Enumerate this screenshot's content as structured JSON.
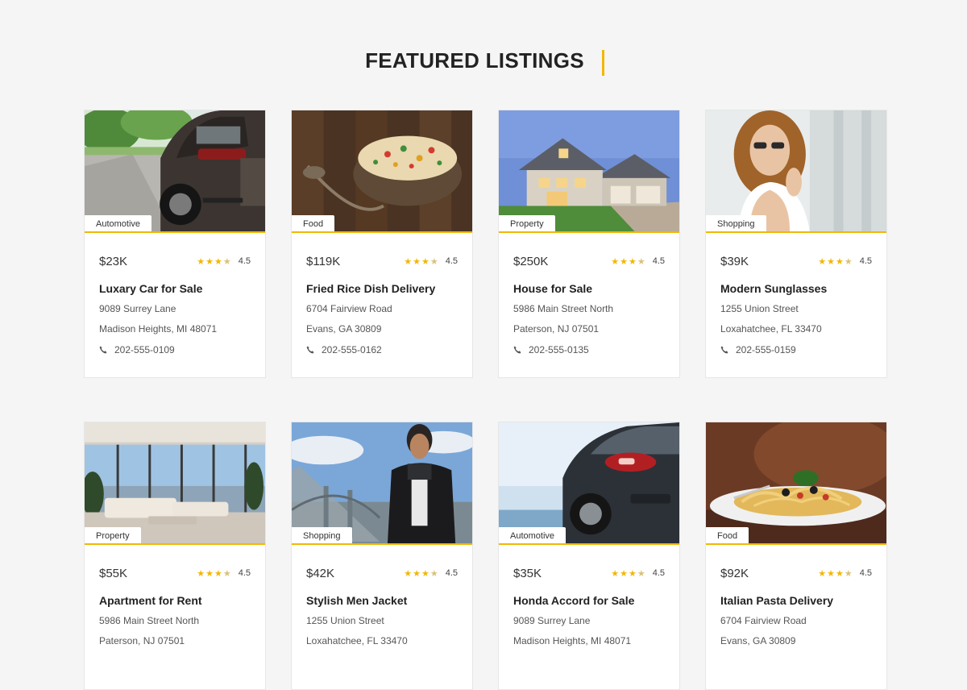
{
  "section_title": "FEATURED LISTINGS",
  "accent_color": "#f2b705",
  "listings": [
    {
      "category": "Automotive",
      "price": "$23K",
      "rating": "4.5",
      "title": "Luxary Car for Sale",
      "address_line1": "9089 Surrey Lane",
      "address_line2": "Madison Heights, MI 48071",
      "phone": "202-555-0109",
      "image": "car-on-road"
    },
    {
      "category": "Food",
      "price": "$119K",
      "rating": "4.5",
      "title": "Fried Rice Dish Delivery",
      "address_line1": "6704 Fairview Road",
      "address_line2": "Evans, GA 30809",
      "phone": "202-555-0162",
      "image": "fried-rice-bowl"
    },
    {
      "category": "Property",
      "price": "$250K",
      "rating": "4.5",
      "title": "House for Sale",
      "address_line1": "5986 Main Street North",
      "address_line2": "Paterson, NJ 07501",
      "phone": "202-555-0135",
      "image": "house-exterior"
    },
    {
      "category": "Shopping",
      "price": "$39K",
      "rating": "4.5",
      "title": "Modern Sunglasses",
      "address_line1": "1255 Union Street",
      "address_line2": "Loxahatchee, FL 33470",
      "phone": "202-555-0159",
      "image": "woman-sunglasses"
    },
    {
      "category": "Property",
      "price": "$55K",
      "rating": "4.5",
      "title": "Apartment for Rent",
      "address_line1": "5986 Main Street North",
      "address_line2": "Paterson, NJ 07501",
      "phone": "",
      "image": "apartment-interior"
    },
    {
      "category": "Shopping",
      "price": "$42K",
      "rating": "4.5",
      "title": "Stylish Men Jacket",
      "address_line1": "1255 Union Street",
      "address_line2": "Loxahatchee, FL 33470",
      "phone": "",
      "image": "man-jacket-bridge"
    },
    {
      "category": "Automotive",
      "price": "$35K",
      "rating": "4.5",
      "title": "Honda Accord for Sale",
      "address_line1": "9089 Surrey Lane",
      "address_line2": "Madison Heights, MI 48071",
      "phone": "",
      "image": "sports-car"
    },
    {
      "category": "Food",
      "price": "$92K",
      "rating": "4.5",
      "title": "Italian Pasta Delivery",
      "address_line1": "6704 Fairview Road",
      "address_line2": "Evans, GA 30809",
      "phone": "",
      "image": "pasta-plate"
    }
  ]
}
